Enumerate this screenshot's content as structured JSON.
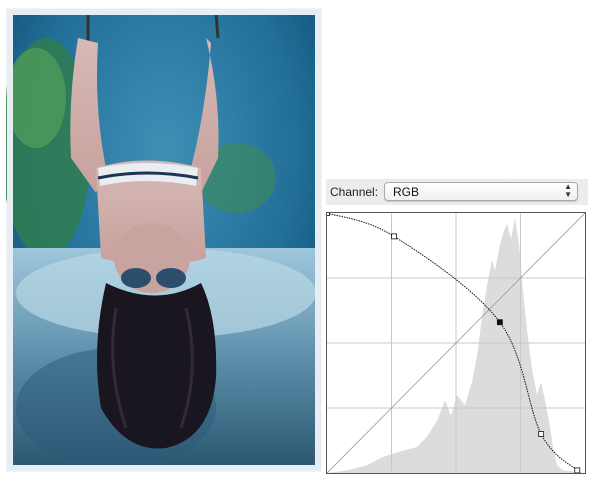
{
  "curves": {
    "channel_label": "Channel:",
    "channel_value": "RGB",
    "channel_icon": "updown-arrows-icon",
    "grid_divisions": 4,
    "curve_points": [
      [
        0,
        100
      ],
      [
        26,
        91
      ],
      [
        67,
        58
      ],
      [
        83,
        15
      ],
      [
        97,
        1
      ]
    ],
    "selected_point": [
      67,
      58
    ]
  }
}
